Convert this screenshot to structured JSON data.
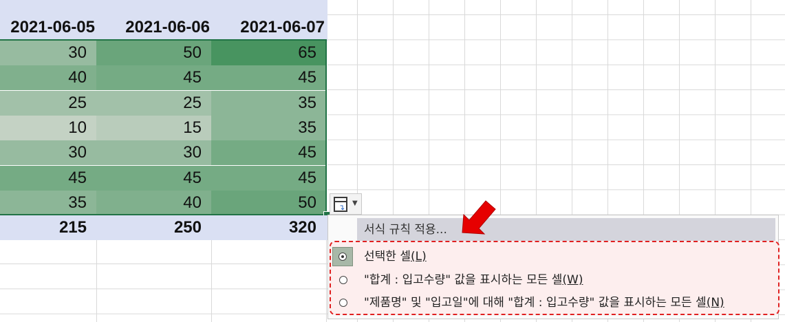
{
  "headers": [
    "2021-06-05",
    "2021-06-06",
    "2021-06-07"
  ],
  "rows": [
    {
      "values": [
        "30",
        "50",
        "65"
      ]
    },
    {
      "values": [
        "40",
        "45",
        "45"
      ]
    },
    {
      "values": [
        "25",
        "25",
        "35"
      ]
    },
    {
      "values": [
        "10",
        "15",
        "35"
      ]
    },
    {
      "values": [
        "30",
        "30",
        "45"
      ]
    },
    {
      "values": [
        "45",
        "45",
        "45"
      ]
    },
    {
      "values": [
        "35",
        "40",
        "50"
      ]
    }
  ],
  "totals": [
    "215",
    "250",
    "320"
  ],
  "colors": {
    "selection_border": "#217346",
    "header_band": "#dae0f3",
    "highlight_border": "#e02020",
    "arrow": "#e60000"
  },
  "format_options_button": {
    "icon": "formatting-options-icon"
  },
  "menu": {
    "header": "서식 규칙 적용...",
    "options": [
      {
        "text": "선택한 셀",
        "key": "(L)",
        "selected": true
      },
      {
        "text": "\"합계 : 입고수량\" 값을 표시하는 모든 셀",
        "key": "(W)",
        "selected": false
      },
      {
        "text": "\"제품명\" 및 \"입고일\"에 대해 \"합계 : 입고수량\" 값을 표시하는 모든 셀",
        "key": "(N)",
        "selected": false
      }
    ]
  }
}
